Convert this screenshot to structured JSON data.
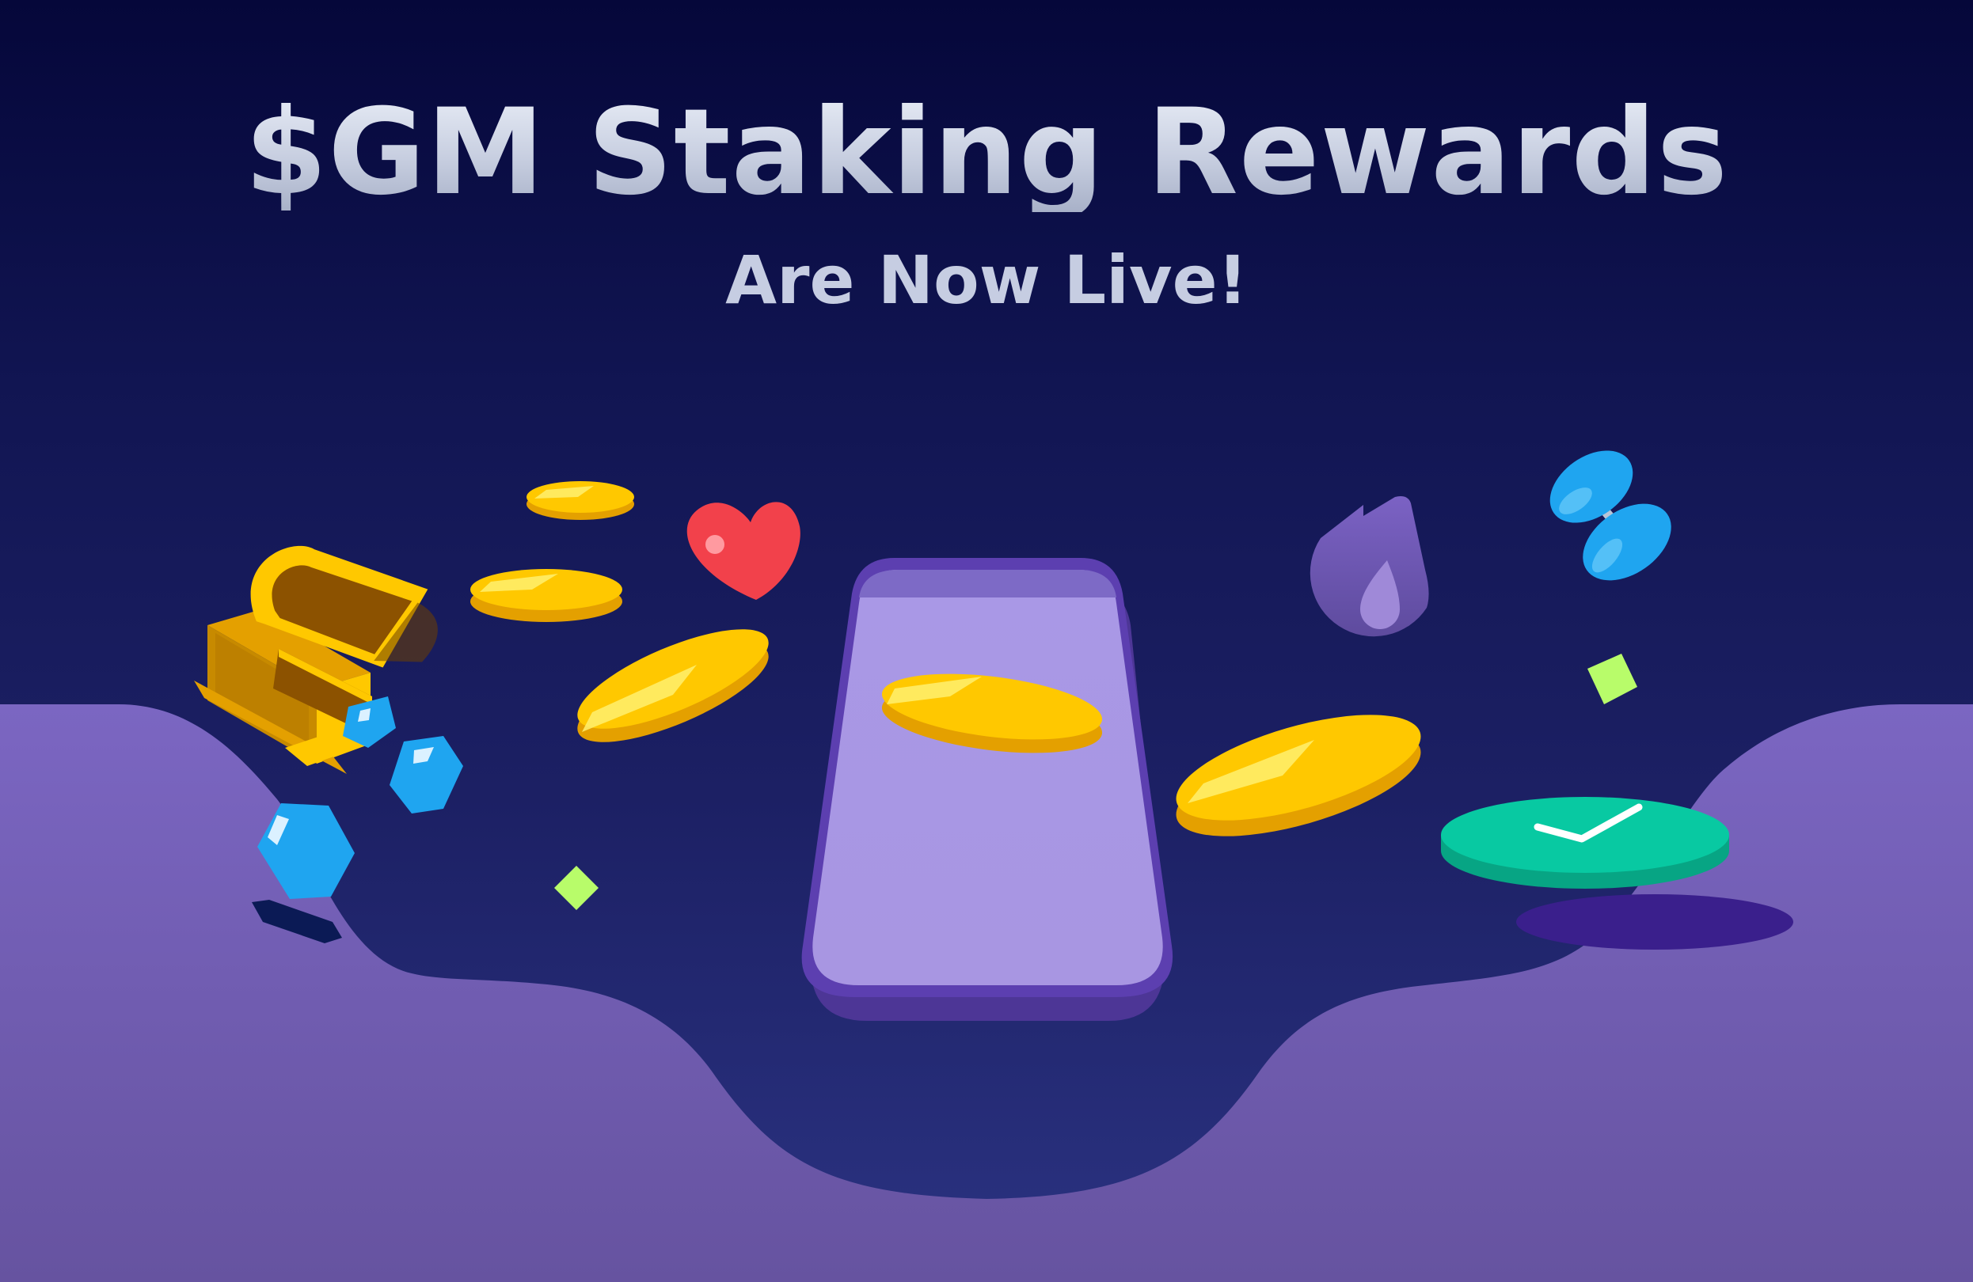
{
  "banner": {
    "title": "$GM Staking Rewards",
    "subtitle": "Are Now Live!"
  },
  "colors": {
    "background_top": "#05073a",
    "background_bottom": "#2b3382",
    "wave": "#7a64bd",
    "coin_gold": "#ffc800",
    "coin_edge": "#e4a000",
    "phone_screen": "#a899e3",
    "phone_frame": "#5c3fb0",
    "gem_blue": "#1fa5f0",
    "heart_red": "#f2414b",
    "check_teal": "#08c9a2",
    "accent_lime": "#b8fc6a"
  },
  "icons": [
    "treasure-chest-icon",
    "gold-coin-icon",
    "heart-icon",
    "phone-icon",
    "flame-drop-icon",
    "dumbbell-icon",
    "checkmark-badge-icon",
    "blue-gem-icon",
    "lime-diamond-icon"
  ]
}
